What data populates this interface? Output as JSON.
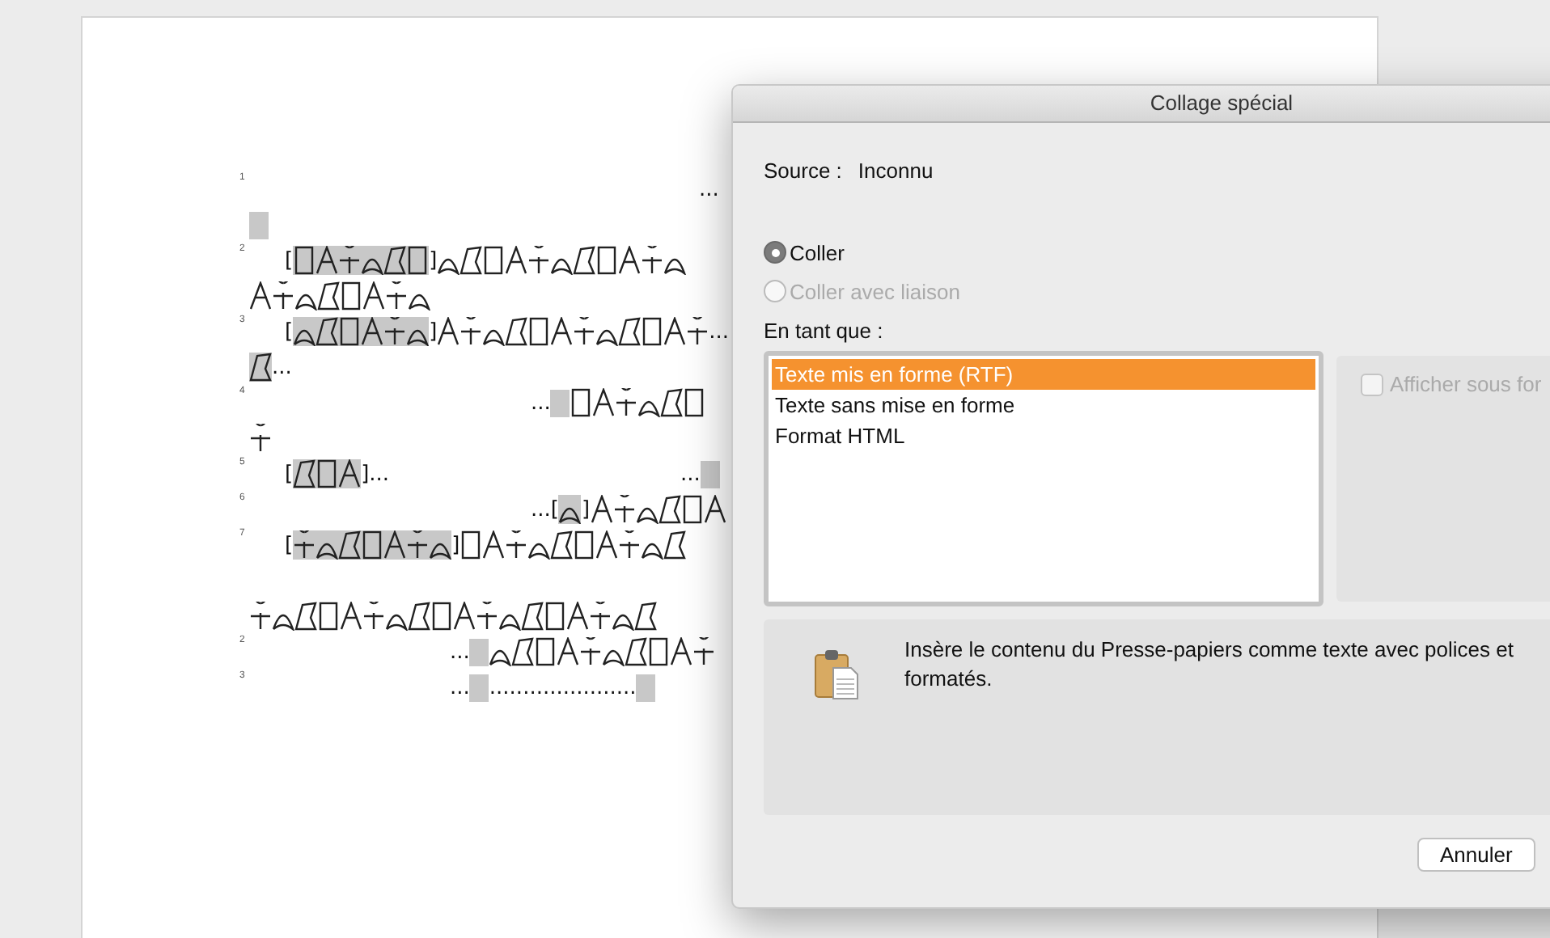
{
  "document": {
    "lines": [
      {
        "number": "1",
        "segments": [
          {
            "kind": "space"
          },
          {
            "kind": "text",
            "text": "..."
          }
        ]
      },
      {
        "segments": [
          {
            "kind": "blank"
          }
        ]
      },
      {
        "number": "2",
        "segments": [
          {
            "kind": "space"
          },
          {
            "kind": "text",
            "text": "["
          },
          {
            "kind": "glyphs",
            "shaded": true
          },
          {
            "kind": "text",
            "text": "]"
          },
          {
            "kind": "glyphs",
            "shaded": false
          }
        ]
      },
      {
        "segments": [
          {
            "kind": "glyphs",
            "shaded": false
          }
        ]
      },
      {
        "number": "3",
        "segments": [
          {
            "kind": "space"
          },
          {
            "kind": "text",
            "text": "["
          },
          {
            "kind": "glyphs",
            "shaded": true
          },
          {
            "kind": "text",
            "text": "]"
          },
          {
            "kind": "glyphs",
            "shaded": false
          },
          {
            "kind": "text",
            "text": "..."
          }
        ]
      },
      {
        "segments": [
          {
            "kind": "glyphs",
            "shaded": true
          },
          {
            "kind": "text",
            "text": "..."
          }
        ]
      },
      {
        "number": "4",
        "segments": [
          {
            "kind": "space"
          },
          {
            "kind": "text",
            "text": "..."
          },
          {
            "kind": "blank"
          },
          {
            "kind": "glyphs",
            "shaded": false
          }
        ]
      },
      {
        "segments": [
          {
            "kind": "glyphs",
            "shaded": false
          }
        ]
      },
      {
        "number": "5",
        "segments": [
          {
            "kind": "space"
          },
          {
            "kind": "text",
            "text": "["
          },
          {
            "kind": "glyphs",
            "shaded": true
          },
          {
            "kind": "text",
            "text": "]..."
          },
          {
            "kind": "space"
          },
          {
            "kind": "text",
            "text": "..."
          },
          {
            "kind": "blank"
          }
        ]
      },
      {
        "number": "6",
        "segments": [
          {
            "kind": "space"
          },
          {
            "kind": "text",
            "text": "...["
          },
          {
            "kind": "glyphs",
            "shaded": true
          },
          {
            "kind": "text",
            "text": "]"
          },
          {
            "kind": "glyphs",
            "shaded": false
          }
        ]
      },
      {
        "number": "7",
        "segments": [
          {
            "kind": "space"
          },
          {
            "kind": "text",
            "text": "["
          },
          {
            "kind": "glyphs",
            "shaded": true
          },
          {
            "kind": "text",
            "text": "]"
          },
          {
            "kind": "glyphs",
            "shaded": false
          }
        ]
      },
      {
        "segments": [
          {
            "kind": "space"
          }
        ]
      },
      {
        "segments": [
          {
            "kind": "glyphs",
            "shaded": false
          }
        ]
      },
      {
        "number": "2",
        "segments": [
          {
            "kind": "space"
          },
          {
            "kind": "text",
            "text": "..."
          },
          {
            "kind": "blank"
          },
          {
            "kind": "glyphs",
            "shaded": false
          }
        ]
      },
      {
        "number": "3",
        "segments": [
          {
            "kind": "space"
          },
          {
            "kind": "text",
            "text": "..."
          },
          {
            "kind": "blank"
          },
          {
            "kind": "text",
            "text": "......................"
          },
          {
            "kind": "blank"
          }
        ]
      }
    ]
  },
  "dialog": {
    "title": "Collage spécial",
    "source_label": "Source :",
    "source_value": "Inconnu",
    "radios": [
      {
        "label": "Coller",
        "selected": true,
        "disabled": false
      },
      {
        "label": "Coller avec liaison",
        "selected": false,
        "disabled": true
      }
    ],
    "list_label": "En tant que :",
    "formats": [
      {
        "label": "Texte mis en forme (RTF)",
        "selected": true
      },
      {
        "label": "Texte sans mise en forme",
        "selected": false
      },
      {
        "label": "Format HTML",
        "selected": false
      }
    ],
    "icon_option": {
      "label": "Afficher sous for",
      "checked": false,
      "disabled": true
    },
    "description": "Insère le contenu du Presse-papiers comme texte avec polices et formatés.",
    "buttons": [
      "Annuler"
    ]
  }
}
